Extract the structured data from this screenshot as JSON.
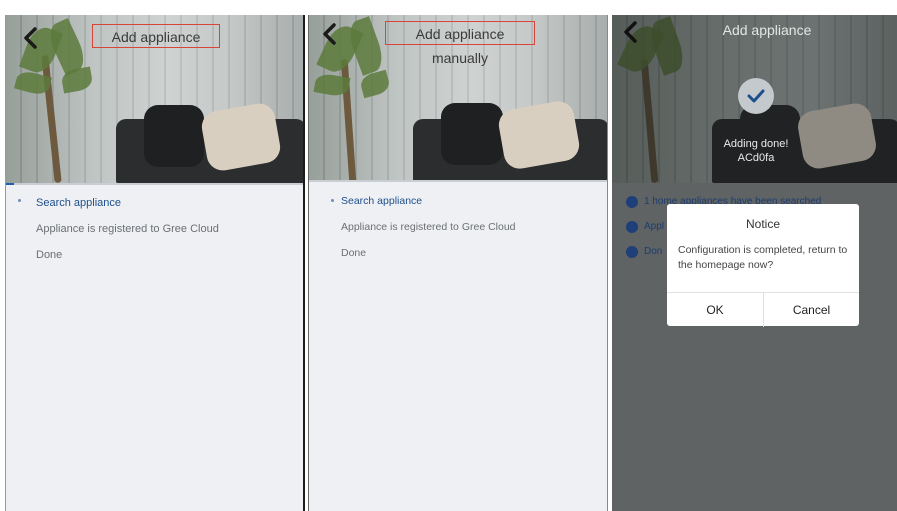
{
  "panels": [
    {
      "title": "Add appliance",
      "steps": [
        "Search appliance",
        "Appliance is registered to Gree Cloud",
        "Done"
      ]
    },
    {
      "title": "Add appliance manually",
      "steps": [
        "Search appliance",
        "Appliance is registered to Gree Cloud",
        "Done"
      ]
    },
    {
      "title": "Add appliance",
      "adding_status": "Adding done!",
      "device_id": "ACd0fa",
      "done_rows": [
        "1 home appliances have been searched",
        "Appl",
        "Don"
      ],
      "dialog": {
        "title": "Notice",
        "message": "Configuration is completed, return to the homepage now?",
        "ok_label": "OK",
        "cancel_label": "Cancel"
      }
    }
  ],
  "colors": {
    "active_step": "#1e4f8c",
    "inactive_step": "#6c6f73",
    "highlight_box": "#d9443a",
    "overlay": "#5f6364"
  },
  "icons": [
    "back-arrow-icon",
    "checkmark-icon",
    "check-circle-icon"
  ]
}
